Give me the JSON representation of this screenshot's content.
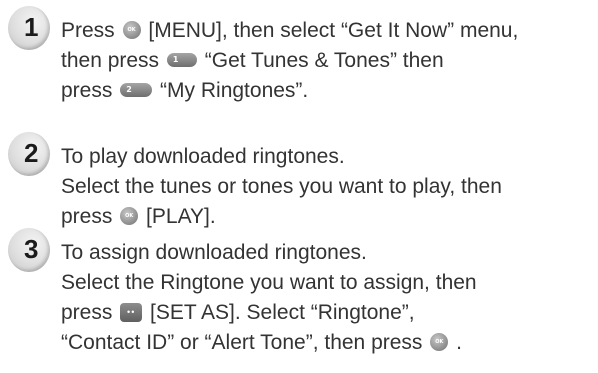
{
  "steps": [
    {
      "number": "1",
      "lines": [
        {
          "a": "Press",
          "b": "[MENU], then select “Get It Now” menu,"
        },
        {
          "a": "then press",
          "b": "“Get Tunes & Tones” then"
        },
        {
          "a": "press",
          "b": "“My Ringtones”."
        }
      ]
    },
    {
      "number": "2",
      "lines": [
        {
          "a": "To play downloaded ringtones."
        },
        {
          "a": "Select the tunes or tones you want to play, then"
        },
        {
          "a": "press",
          "b": "[PLAY]."
        }
      ]
    },
    {
      "number": "3",
      "lines": [
        {
          "a": "To assign downloaded ringtones."
        },
        {
          "a": "Select the Ringtone you want to assign, then"
        },
        {
          "a": "press",
          "b": "[SET AS]. Select “Ringtone”,"
        },
        {
          "a": "“Contact ID” or “Alert Tone”, then press",
          "b": "."
        }
      ]
    }
  ],
  "keys": {
    "key_1_label": "1",
    "key_2_label": "2"
  },
  "icons": {
    "ok": "ok-key-icon",
    "key1": "key-1-icon",
    "key2": "key-2-icon",
    "soft": "left-soft-key-icon"
  }
}
